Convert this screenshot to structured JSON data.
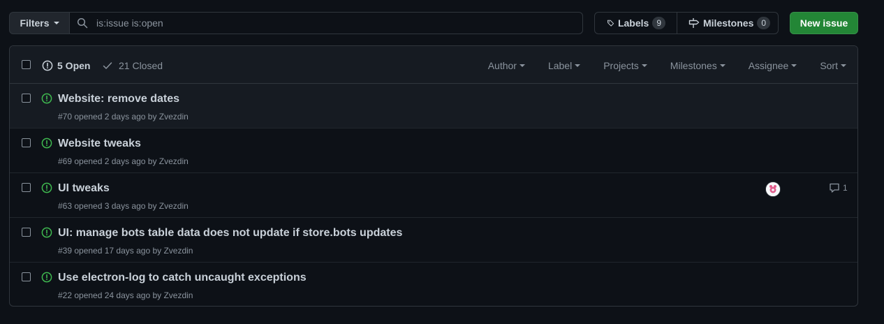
{
  "toolbar": {
    "filters_label": "Filters",
    "search_value": "is:issue is:open",
    "labels_label": "Labels",
    "labels_count": "9",
    "milestones_label": "Milestones",
    "milestones_count": "0",
    "new_issue_label": "New issue"
  },
  "header": {
    "open_label": "5 Open",
    "closed_label": "21 Closed",
    "filters": [
      "Author",
      "Label",
      "Projects",
      "Milestones",
      "Assignee",
      "Sort"
    ]
  },
  "issues": [
    {
      "title": "Website: remove dates",
      "meta": "#70 opened 2 days ago by Zvezdin"
    },
    {
      "title": "Website tweaks",
      "meta": "#69 opened 2 days ago by Zvezdin"
    },
    {
      "title": "UI tweaks",
      "meta": "#63 opened 3 days ago by Zvezdin",
      "comments": "1"
    },
    {
      "title": "UI: manage bots table data does not update if store.bots updates",
      "meta": "#39 opened 17 days ago by Zvezdin"
    },
    {
      "title": "Use electron-log to catch uncaught exceptions",
      "meta": "#22 opened 24 days ago by Zvezdin"
    }
  ],
  "colors": {
    "open_green": "#3fb950",
    "primary_button": "#238636",
    "background": "#0d1117"
  }
}
